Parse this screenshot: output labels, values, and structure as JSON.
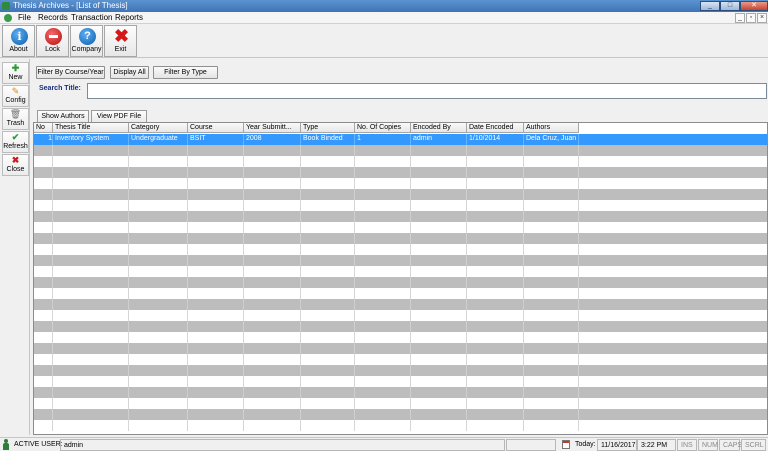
{
  "window": {
    "title": "Thesis Archives - [List of Thesis]"
  },
  "menu": {
    "items": [
      "File",
      "Records",
      "Transaction",
      "Reports"
    ]
  },
  "toolbar": {
    "buttons": [
      "About",
      "Lock",
      "Company",
      "Exit"
    ]
  },
  "sidebar": {
    "items": [
      "New",
      "Config",
      "Trash",
      "Refresh",
      "Close"
    ]
  },
  "filters": {
    "buttons": [
      "Filter By Course/Year",
      "Display All",
      "Filter By Type"
    ]
  },
  "search": {
    "label": "Search Title:",
    "value": ""
  },
  "tabs": [
    "Show Authors",
    "View PDF File"
  ],
  "grid": {
    "columns": [
      "No",
      "Thesis Title",
      "Category",
      "Course",
      "Year Submitt...",
      "Type",
      "No. Of Copies",
      "Encoded By",
      "Date Encoded",
      "Authors"
    ],
    "rows": [
      [
        "1",
        "Inventory System",
        "Undergraduate",
        "BSIT",
        "2008",
        "Book Binded",
        "1",
        "admin",
        "1/10/2014",
        "Dela Cruz, Juan"
      ]
    ]
  },
  "status": {
    "user_label": "ACTIVE USER:",
    "user": "admin",
    "today_label": "Today:",
    "date": "11/16/2017",
    "time": "3:22 PM",
    "keys": [
      "INS",
      "NUM",
      "CAPS",
      "SCRL"
    ]
  },
  "colors": {
    "selected_row": "#3399ff",
    "alt_row": "#bdbdbd",
    "title_bar": "#4a80c2"
  },
  "icons": {
    "about": "info-icon",
    "lock": "lock-icon",
    "company": "help-icon",
    "exit": "close-x-icon",
    "new": "plus-icon",
    "config": "pencil-icon",
    "trash": "trash-icon",
    "refresh": "checkmark-icon",
    "close": "close-x-icon"
  }
}
